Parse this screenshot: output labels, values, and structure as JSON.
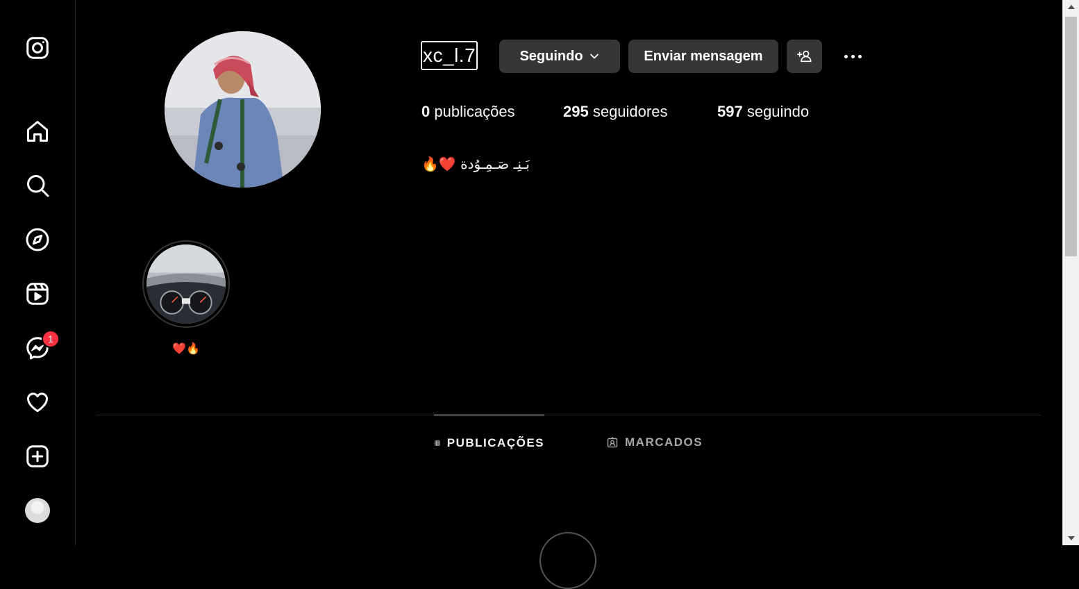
{
  "nav": {
    "items": [
      {
        "name": "instagram-logo-icon"
      },
      {
        "name": "home-icon"
      },
      {
        "name": "search-icon"
      },
      {
        "name": "explore-icon"
      },
      {
        "name": "reels-icon"
      },
      {
        "name": "messenger-icon",
        "badge": "1"
      },
      {
        "name": "notifications-heart-icon"
      },
      {
        "name": "create-icon"
      },
      {
        "name": "profile-avatar"
      }
    ]
  },
  "profile": {
    "username": "xc_l.7",
    "follow_button": "Seguindo",
    "message_button": "Enviar mensagem",
    "stats": {
      "posts_count": "0",
      "posts_label": " publicações",
      "followers_count": "295",
      "followers_label": " seguidores",
      "following_count": "597",
      "following_label": " seguindo"
    },
    "bio": "🔥❤️ بَـنِـ صَـمِـوُدة"
  },
  "highlights": [
    {
      "label": "❤️🔥"
    }
  ],
  "tabs": {
    "posts": "PUBLICAÇÕES",
    "tagged": "MARCADOS",
    "active": "posts"
  },
  "colors": {
    "background": "#000000",
    "button_bg": "#363636",
    "badge": "#ff3040",
    "divider": "#262626"
  }
}
